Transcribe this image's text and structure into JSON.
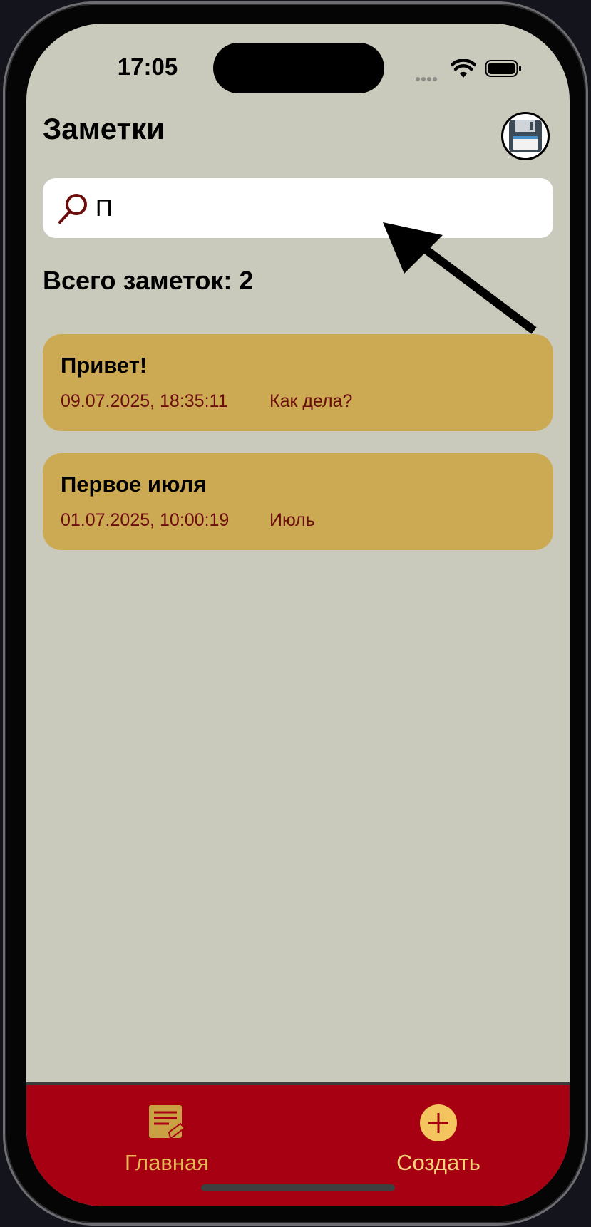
{
  "status_bar": {
    "time": "17:05"
  },
  "header": {
    "title": "Заметки",
    "save_icon": "floppy-disk-icon"
  },
  "search": {
    "value": "П",
    "icon": "search-icon"
  },
  "notes_count_text": "Всего заметок: 2",
  "notes": [
    {
      "title": "Привет!",
      "date": "09.07.2025, 18:35:11",
      "text": "Как дела?"
    },
    {
      "title": "Первое июля",
      "date": "01.07.2025, 10:00:19",
      "text": "Июль"
    }
  ],
  "tabbar": {
    "home_label": "Главная",
    "create_label": "Создать"
  },
  "colors": {
    "background": "#c9cabb",
    "note_card": "#ccaa53",
    "note_secondary_text": "#6b0d0d",
    "tabbar": "#a60012",
    "tab_accent": "#e6b957"
  }
}
